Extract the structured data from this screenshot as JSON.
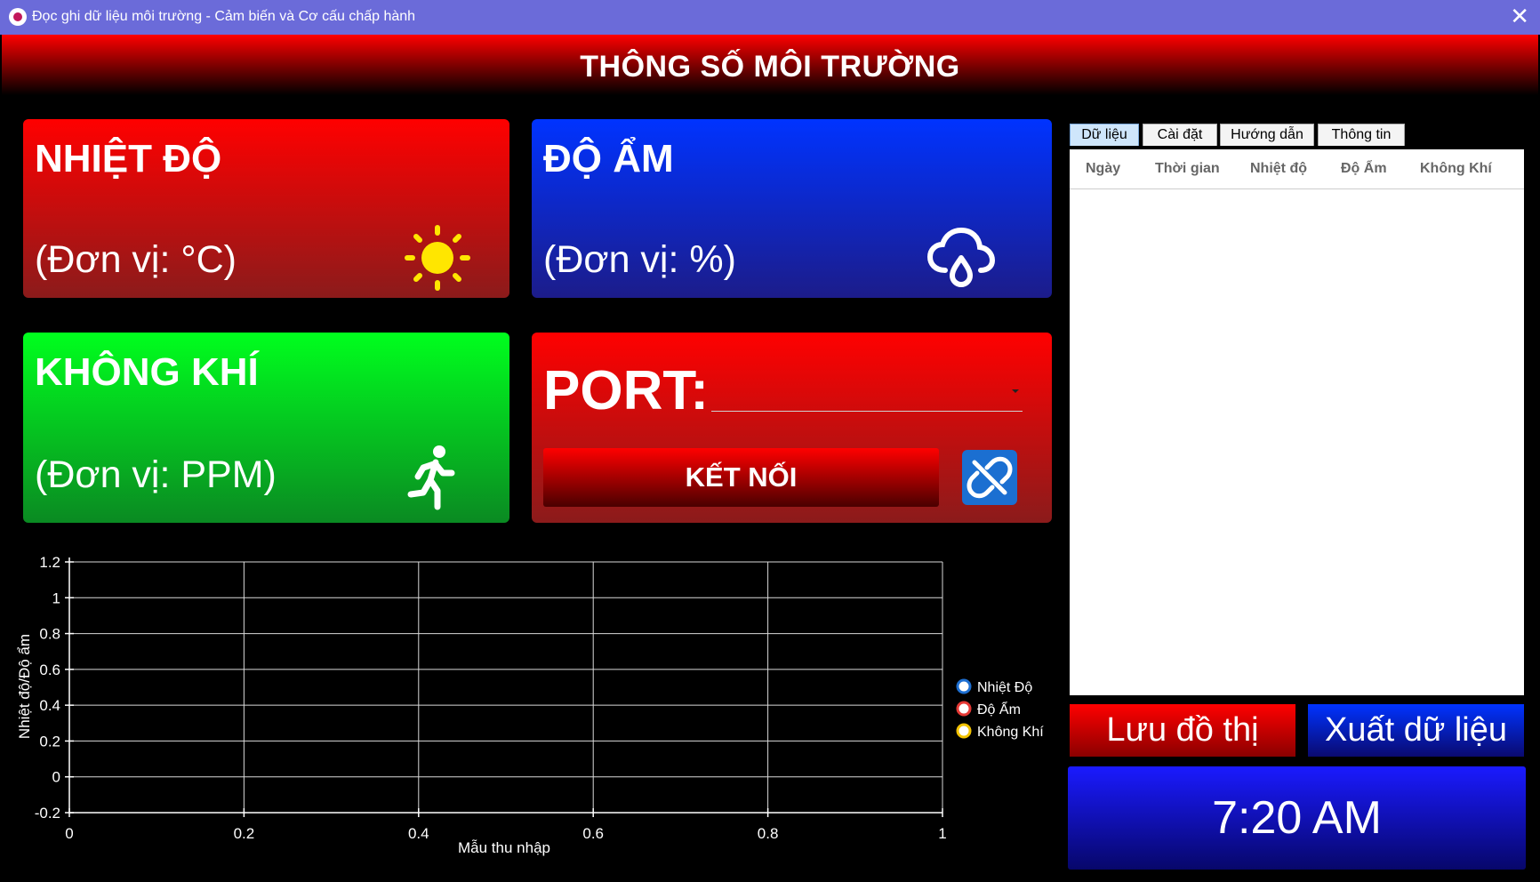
{
  "window": {
    "title": "Đọc ghi dữ liệu môi trường - Cảm biến và Cơ cấu chấp hành",
    "close": "✕"
  },
  "header": {
    "title": "THÔNG SỐ MÔI TRƯỜNG"
  },
  "cards": {
    "temperature": {
      "title": "NHIỆT ĐỘ",
      "unit": "(Đơn vị: °C)",
      "icon": "sun-icon",
      "color": "#ff0000"
    },
    "humidity": {
      "title": "ĐỘ ẨM",
      "unit": "(Đơn vị: %)",
      "icon": "cloud-rain-icon",
      "color": "#0033ff"
    },
    "air": {
      "title": "KHÔNG KHÍ",
      "unit": "(Đơn vị: PPM)",
      "icon": "running-person-icon",
      "color": "#00ff1e"
    },
    "port": {
      "label": "PORT:",
      "selected": "",
      "connect_label": "KẾT NỐI",
      "link_icon": "unlink-icon"
    }
  },
  "tabs": [
    {
      "label": "Dữ liệu",
      "active": true
    },
    {
      "label": "Cài đặt"
    },
    {
      "label": "Hướng dẫn"
    },
    {
      "label": "Thông tin"
    }
  ],
  "table": {
    "columns": [
      "Ngày",
      "Thời gian",
      "Nhiệt độ",
      "Độ Ẩm",
      "Không Khí"
    ],
    "rows": []
  },
  "buttons": {
    "save_chart": "Lưu đồ thị",
    "export_data": "Xuất dữ liệu"
  },
  "clock": {
    "time": "7:20 AM"
  },
  "chart_data": {
    "type": "line",
    "xlabel": "Mẫu thu nhập",
    "ylabel": "Nhiệt độ/Độ ẩm",
    "xlim": [
      0,
      1
    ],
    "ylim": [
      -0.2,
      1.2
    ],
    "xticks": [
      "0",
      "0.2",
      "0.4",
      "0.6",
      "0.8",
      "1"
    ],
    "yticks": [
      "-0.2",
      "0",
      "0.2",
      "0.4",
      "0.6",
      "0.8",
      "1",
      "1.2"
    ],
    "grid": true,
    "legend_position": "right",
    "series": [
      {
        "name": "Nhiệt Độ",
        "values": [],
        "color": "#1e6fd1"
      },
      {
        "name": "Độ Ẩm",
        "values": [],
        "color": "#e53935"
      },
      {
        "name": "Không Khí",
        "values": [],
        "color": "#f2c200"
      }
    ]
  }
}
